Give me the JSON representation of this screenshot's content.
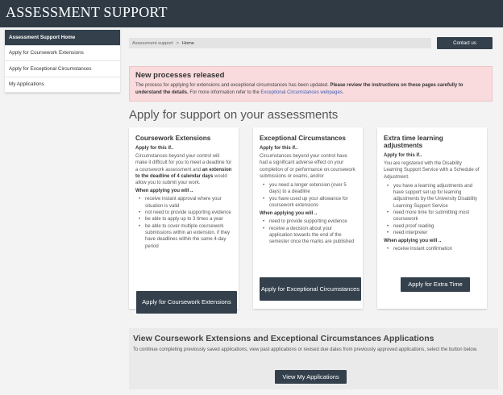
{
  "header": {
    "title": "ASSESSMENT SUPPORT"
  },
  "sidebar": {
    "items": [
      {
        "label": "Assessment Support Home"
      },
      {
        "label": "Apply for Coursework Extensions"
      },
      {
        "label": "Apply for Exceptional Circumstances"
      },
      {
        "label": "My Applications"
      }
    ]
  },
  "breadcrumb": {
    "root": "Assessment support",
    "separator": ">",
    "current": "Home"
  },
  "contact": {
    "label": "Contact us"
  },
  "alert": {
    "title": "New processes released",
    "text1": "The process for applying for extensions and exceptional circumstances has been updated.",
    "bold": "Please review the instructions on these pages carefully to understand the details.",
    "text2": "For more information refer to the",
    "link": "Exceptional Circumstances webpages",
    "text3": "."
  },
  "main": {
    "heading": "Apply for support on your assessments"
  },
  "cards": [
    {
      "title": "Coursework Extensions",
      "apply_if": "Apply for this if..",
      "body_pre": "Circumstances beyond your control will make it difficult for you to meet a deadline for a coursework assessment and",
      "body_bold": "an extension to the deadline of 4 calendar days",
      "body_post": "would allow you to submit your work.",
      "when_label": "When applying you will ..",
      "when": [
        "receive instant approval where your situation is valid",
        "not need to provide supporting evidence",
        "be able to apply up to 3 times a year",
        "be able to cover multiple coursework submissions within an extension, if they have deadlines within the same 4-day period"
      ],
      "button": "Apply for Coursework Extensions"
    },
    {
      "title": "Exceptional Circumstances",
      "apply_if": "Apply for this if..",
      "body": "Circumstances beyond your control have had a significant adverse effect on your completion of or performance on coursework submissions or exams, and/or",
      "conditions": [
        "you need a longer extension (over 5 days) to a deadline",
        "you have used up your allowance for coursework extensions"
      ],
      "when_label": "When applying you will ..",
      "when": [
        "need to provide supporting evidence",
        "receive a decision about your application towards the end of the semester once the marks are published"
      ],
      "button": "Apply for Exceptional Circumstances"
    },
    {
      "title": "Extra time learning adjustments",
      "apply_if": "Apply for this if..",
      "body": "You are registered with the Disability Learning Support Service with a Schedule of Adjustment.",
      "conditions": [
        "you have a learning adjustments and have support set up for learning adjustments by the University Disability Learning Support Service",
        "need more time for submitting most coursework",
        "need proof reading",
        "need interpreter"
      ],
      "when_label": "When applying you will ..",
      "when": [
        "receive instant confirmation"
      ],
      "button": "Apply for Extra Time"
    }
  ],
  "applications": {
    "heading": "View Coursework Extensions and Exceptional Circumstances Applications",
    "text": "To continue completing previously saved applications, view past applications or revised due dates from previously approved applications, select the button below.",
    "button": "View My Applications"
  }
}
